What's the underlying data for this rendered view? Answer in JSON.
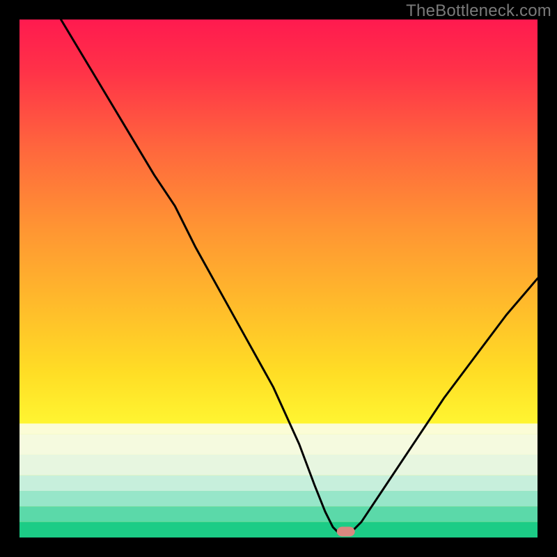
{
  "watermark": "TheBottleneck.com",
  "chart_data": {
    "type": "line",
    "title": "",
    "xlabel": "",
    "ylabel": "",
    "xlim": [
      0,
      100
    ],
    "ylim": [
      0,
      100
    ],
    "x": [
      8,
      14,
      20,
      26,
      30,
      34,
      39,
      44,
      49,
      54,
      57,
      59,
      60.5,
      62,
      63.5,
      66,
      70,
      76,
      82,
      88,
      94,
      100
    ],
    "values": [
      100,
      90,
      80,
      70,
      64,
      56,
      47,
      38,
      29,
      18,
      10,
      5,
      2,
      0.5,
      0.5,
      3,
      9,
      18,
      27,
      35,
      43,
      50
    ],
    "bottom_gradient_bands": [
      {
        "y0": 78,
        "y1": 80,
        "color": "#fbfcd6"
      },
      {
        "y0": 80,
        "y1": 84,
        "color": "#f5fadf"
      },
      {
        "y0": 84,
        "y1": 88,
        "color": "#e7f6e0"
      },
      {
        "y0": 88,
        "y1": 91,
        "color": "#c7efdc"
      },
      {
        "y0": 91,
        "y1": 94,
        "color": "#97e6c9"
      },
      {
        "y0": 94,
        "y1": 97,
        "color": "#5bd9a9"
      },
      {
        "y0": 97,
        "y1": 100,
        "color": "#1ccc86"
      }
    ],
    "marker": {
      "x": 63,
      "y": 99,
      "color": "#d98880"
    }
  }
}
